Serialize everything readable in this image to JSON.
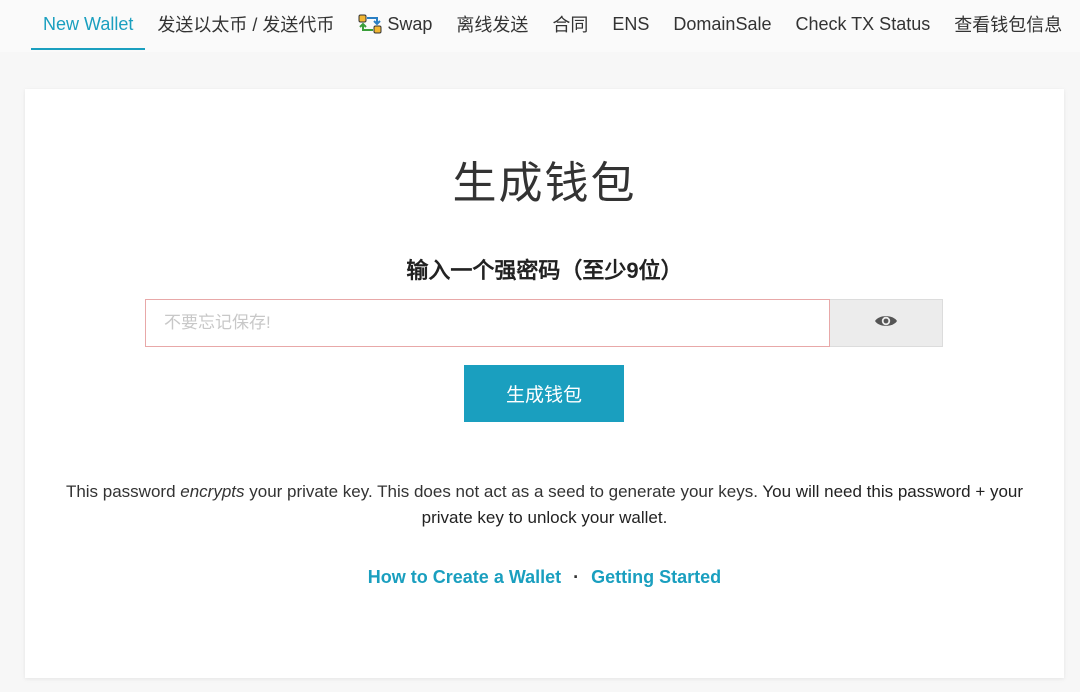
{
  "nav": {
    "items": [
      {
        "label": "New Wallet",
        "active": true
      },
      {
        "label": "发送以太币 / 发送代币",
        "active": false
      },
      {
        "label": "Swap",
        "active": false,
        "icon": "swap-icon"
      },
      {
        "label": "离线发送",
        "active": false
      },
      {
        "label": "合同",
        "active": false
      },
      {
        "label": "ENS",
        "active": false
      },
      {
        "label": "DomainSale",
        "active": false
      },
      {
        "label": "Check TX Status",
        "active": false
      },
      {
        "label": "查看钱包信息",
        "active": false
      }
    ]
  },
  "main": {
    "title": "生成钱包",
    "password_label": "输入一个强密码（至少9位）",
    "password_placeholder": "不要忘记保存!",
    "password_value": "",
    "toggle_icon": "eye-icon",
    "generate_button": "生成钱包",
    "info_part1": "This password ",
    "info_em": "encrypts",
    "info_part2": " your private key. This does not act as a seed to generate your keys. ",
    "info_strong": "You will need this password + your private key to unlock your wallet.",
    "link_create": "How to Create a Wallet",
    "link_separator": "·",
    "link_started": "Getting Started"
  },
  "colors": {
    "accent": "#1a9fbf",
    "input_border": "#e8a8a8",
    "toggle_bg": "#ececec"
  }
}
